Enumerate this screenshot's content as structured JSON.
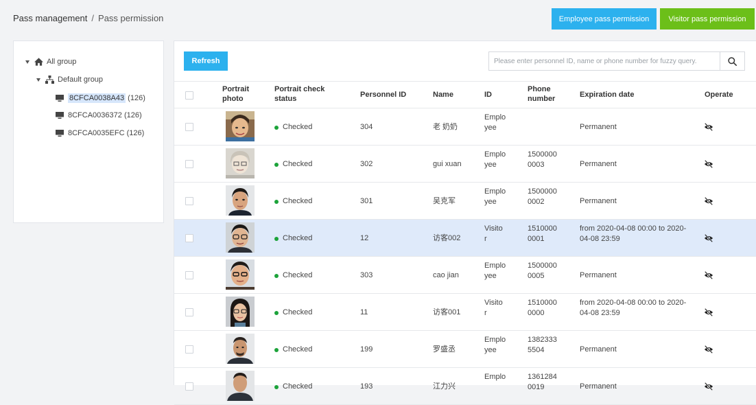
{
  "breadcrumb": {
    "root": "Pass management",
    "separator": "/",
    "current": "Pass permission"
  },
  "header_buttons": {
    "employee": "Employee pass permission",
    "visitor": "Visitor pass permission"
  },
  "tree": {
    "root": "All group",
    "group": "Default group",
    "devices": [
      {
        "id": "8CFCA0038A43",
        "count": "(126)",
        "selected": true
      },
      {
        "id": "8CFCA0036372",
        "count": "(126)",
        "selected": false
      },
      {
        "id": "8CFCA0035EFC",
        "count": "(126)",
        "selected": false
      }
    ]
  },
  "toolbar": {
    "refresh_label": "Refresh",
    "search_placeholder": "Please enter personnel ID, name or phone number for fuzzy query."
  },
  "table": {
    "headers": {
      "portrait_photo": [
        "Portrait",
        "photo"
      ],
      "check_status": [
        "Portrait check",
        "status"
      ],
      "personnel_id": "Personnel ID",
      "name": "Name",
      "id": "ID",
      "phone": [
        "Phone",
        "number"
      ],
      "expiration": "Expiration date",
      "operate": "Operate"
    },
    "rows": [
      {
        "status": "Checked",
        "personnel_id": "304",
        "name": "老 奶奶",
        "id_type": [
          "Emplo",
          "yee"
        ],
        "phone": [
          "",
          ""
        ],
        "expiration": [
          "Permanent",
          ""
        ],
        "highlight": false
      },
      {
        "status": "Checked",
        "personnel_id": "302",
        "name": "gui xuan",
        "id_type": [
          "Emplo",
          "yee"
        ],
        "phone": [
          "1500000",
          "0003"
        ],
        "expiration": [
          "Permanent",
          ""
        ],
        "highlight": false
      },
      {
        "status": "Checked",
        "personnel_id": "301",
        "name": "吴克军",
        "id_type": [
          "Emplo",
          "yee"
        ],
        "phone": [
          "1500000",
          "0002"
        ],
        "expiration": [
          "Permanent",
          ""
        ],
        "highlight": false
      },
      {
        "status": "Checked",
        "personnel_id": "12",
        "name": "访客002",
        "id_type": [
          "Visito",
          "r"
        ],
        "phone": [
          "1510000",
          "0001"
        ],
        "expiration": [
          "from 2020-04-08 00:00 to 2020-",
          "04-08 23:59"
        ],
        "highlight": true
      },
      {
        "status": "Checked",
        "personnel_id": "303",
        "name": "cao jian",
        "id_type": [
          "Emplo",
          "yee"
        ],
        "phone": [
          "1500000",
          "0005"
        ],
        "expiration": [
          "Permanent",
          ""
        ],
        "highlight": false
      },
      {
        "status": "Checked",
        "personnel_id": "11",
        "name": "访客001",
        "id_type": [
          "Visito",
          "r"
        ],
        "phone": [
          "1510000",
          "0000"
        ],
        "expiration": [
          "from 2020-04-08 00:00 to 2020-",
          "04-08 23:59"
        ],
        "highlight": false
      },
      {
        "status": "Checked",
        "personnel_id": "199",
        "name": "罗盛丞",
        "id_type": [
          "Emplo",
          "yee"
        ],
        "phone": [
          "1382333",
          "5504"
        ],
        "expiration": [
          "Permanent",
          ""
        ],
        "highlight": false
      },
      {
        "status": "Checked",
        "personnel_id": "193",
        "name": "江力兴",
        "id_type": [
          "Emplo",
          ""
        ],
        "phone": [
          "1361284",
          "0019"
        ],
        "expiration": [
          "Permanent",
          ""
        ],
        "highlight": false
      }
    ]
  },
  "colors": {
    "primary": "#2cb1ee",
    "visitor": "#6cbf19",
    "checked": "#1ca33a",
    "highlight": "#dfeafa"
  },
  "icons": {
    "operate": "visibility-off-icon",
    "search": "search-icon",
    "root": "home-icon",
    "group": "network-icon",
    "device": "monitor-icon"
  }
}
